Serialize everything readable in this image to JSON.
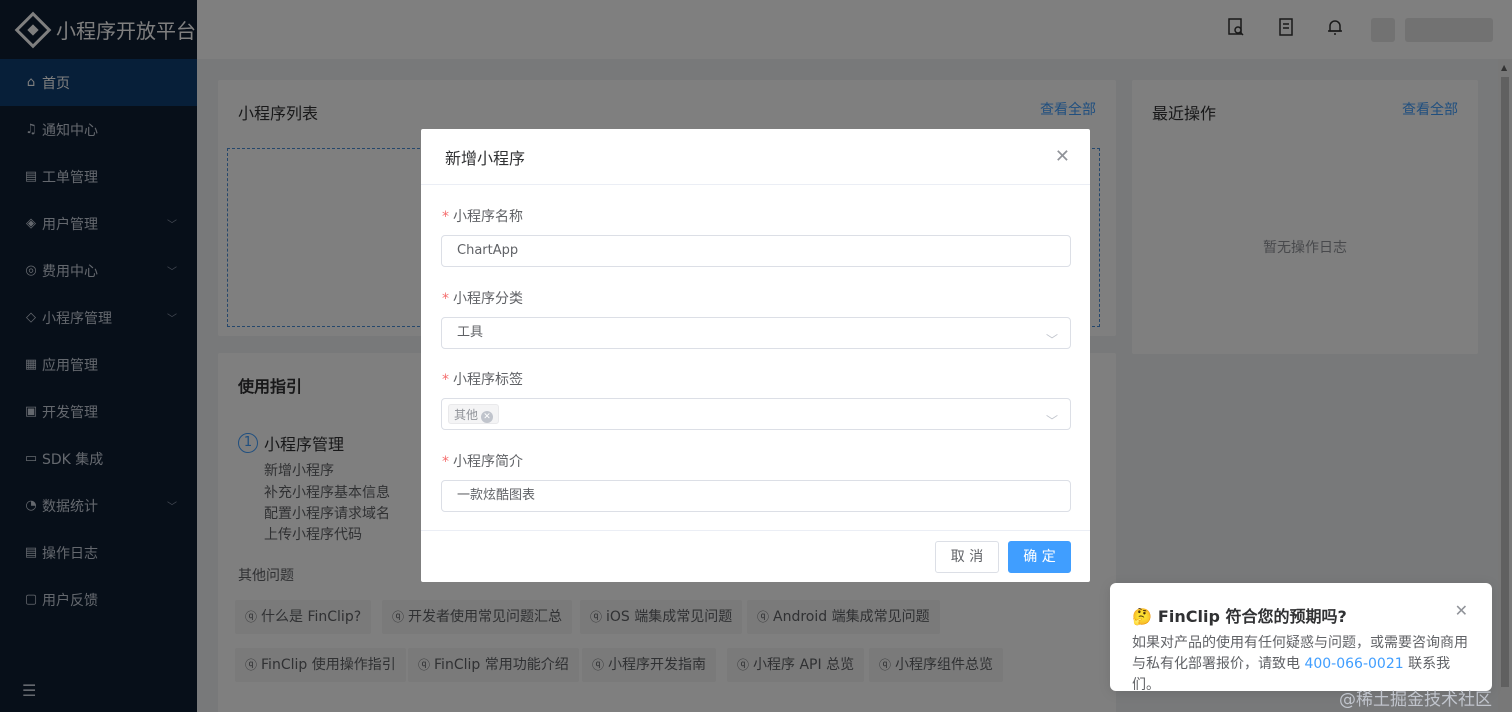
{
  "sidebar": {
    "logo_text": "小程序开放平台",
    "items": [
      {
        "label": "首页",
        "icon": "⌂",
        "active": true
      },
      {
        "label": "通知中心",
        "icon": "♫"
      },
      {
        "label": "工单管理",
        "icon": "▤"
      },
      {
        "label": "用户管理",
        "icon": "◈",
        "arrow": "﹀"
      },
      {
        "label": "费用中心",
        "icon": "◎",
        "arrow": "﹀"
      },
      {
        "label": "小程序管理",
        "icon": "◇",
        "arrow": "﹀"
      },
      {
        "label": "应用管理",
        "icon": "▦"
      },
      {
        "label": "开发管理",
        "icon": "▣"
      },
      {
        "label": "SDK 集成",
        "icon": "▭"
      },
      {
        "label": "数据统计",
        "icon": "◔",
        "arrow": "﹀"
      },
      {
        "label": "操作日志",
        "icon": "▤"
      },
      {
        "label": "用户反馈",
        "icon": "▢"
      }
    ],
    "collapse_icon": "☰"
  },
  "header": {
    "icons": [
      "search-doc-icon",
      "document-icon",
      "bell-icon"
    ]
  },
  "main": {
    "list_card": {
      "title": "小程序列表",
      "link": "查看全部"
    },
    "recent_card": {
      "title": "最近操作",
      "link": "查看全部",
      "empty": "暂无操作日志"
    },
    "guide": {
      "title": "使用指引",
      "step_num": "1",
      "step_title": "小程序管理",
      "links": [
        "新增小程序",
        "补充小程序基本信息",
        "配置小程序请求域名",
        "上传小程序代码"
      ],
      "other_label": "其他问题",
      "faq_row1": [
        "什么是 FinClip?",
        "开发者使用常见问题汇总",
        "iOS 端集成常见问题",
        "Android 端集成常见问题"
      ],
      "faq_row2": [
        "FinClip 使用操作指引",
        "FinClip 常用功能介绍",
        "小程序开发指南",
        "小程序 API 总览",
        "小程序组件总览"
      ]
    }
  },
  "dialog": {
    "title": "新增小程序",
    "name_label": "小程序名称",
    "name_value": "ChartApp",
    "category_label": "小程序分类",
    "category_value": "工具",
    "tags_label": "小程序标签",
    "tag_value": "其他",
    "desc_label": "小程序简介",
    "desc_value": "一款炫酷图表",
    "cancel": "取 消",
    "confirm": "确 定"
  },
  "notification": {
    "emoji": "🤔",
    "title": "FinClip 符合您的预期吗?",
    "body_pre": "如果对产品的使用有任何疑惑与问题，或需要咨询商用与私有化部署报价，请致电",
    "phone": "400-066-0021",
    "body_post": "联系我们。"
  },
  "watermark": "@稀土掘金技术社区",
  "colors": {
    "sidebar_bg": "#0f1e33",
    "active_bg": "#0e3f72",
    "primary": "#409eff",
    "required": "#f56c6c"
  }
}
